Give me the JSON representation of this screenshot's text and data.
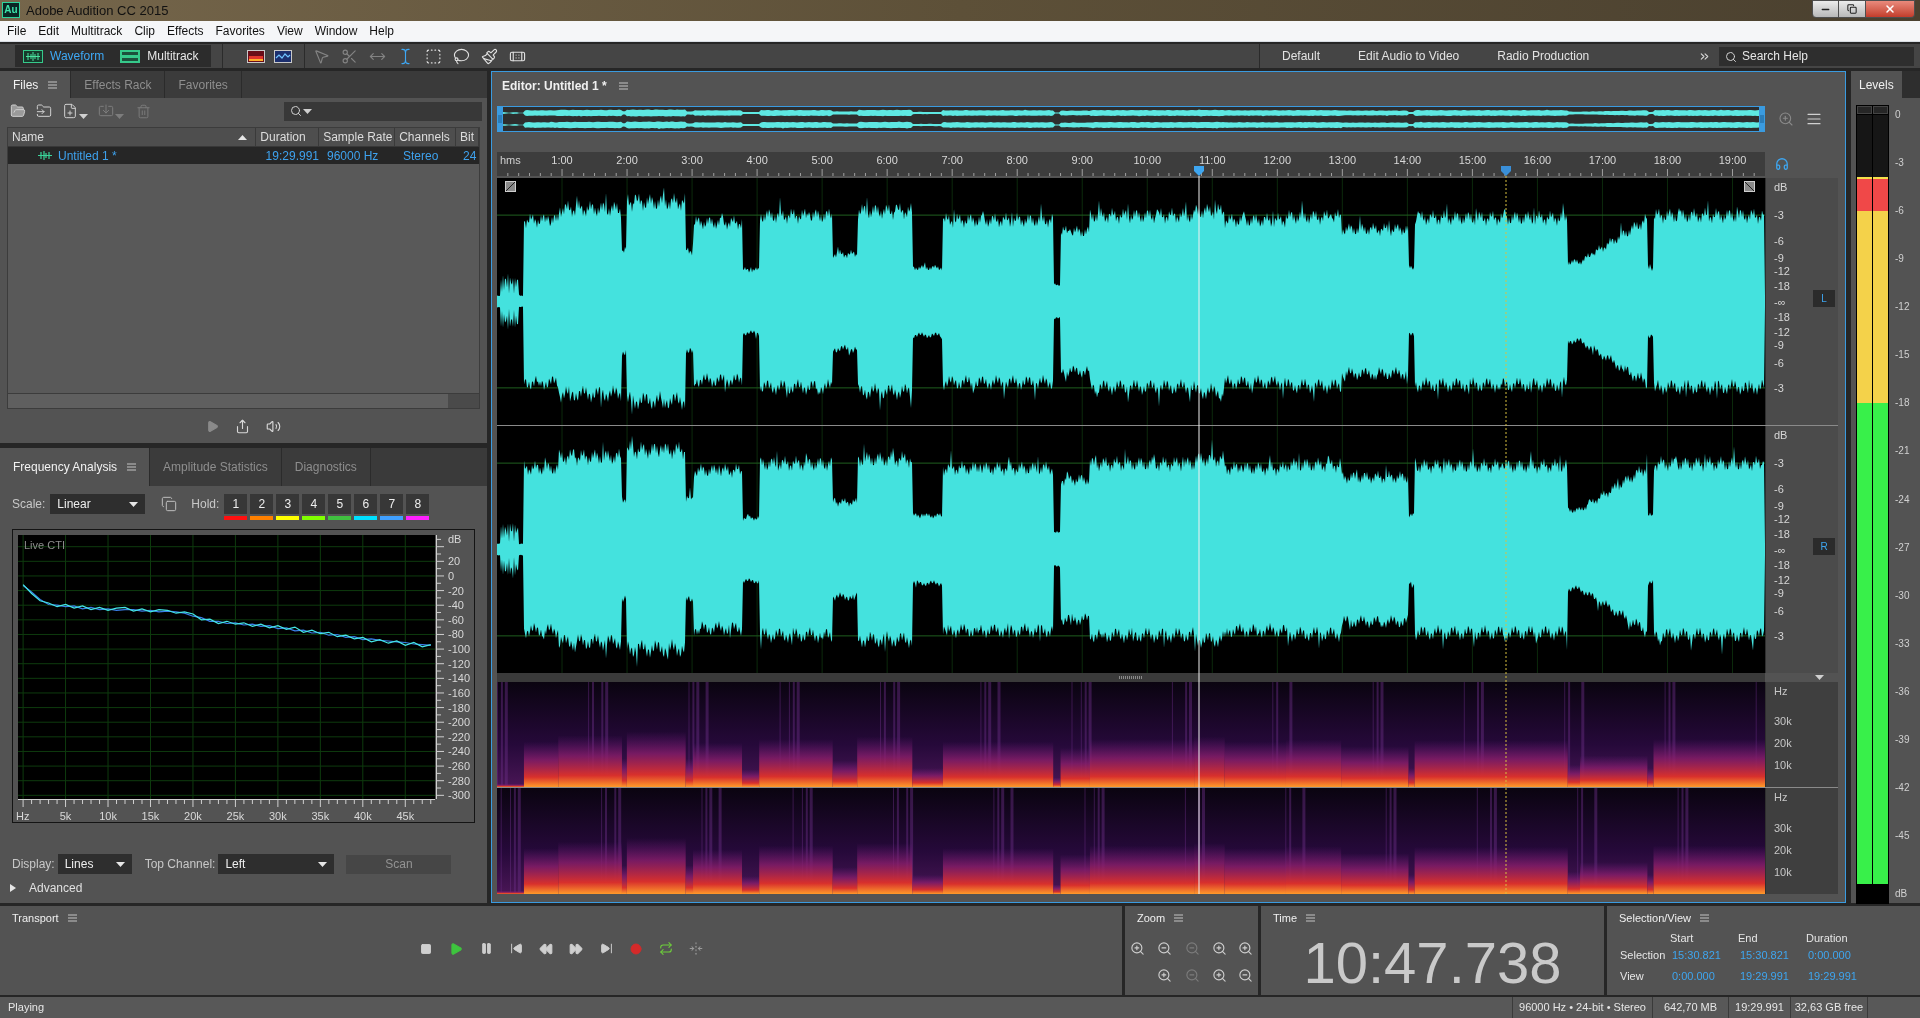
{
  "window": {
    "logo": "Au",
    "title": "Adobe Audition CC 2015"
  },
  "menu": [
    "File",
    "Edit",
    "Multitrack",
    "Clip",
    "Effects",
    "Favorites",
    "View",
    "Window",
    "Help"
  ],
  "toolbar": {
    "views": [
      {
        "label": "Waveform",
        "selected": true
      },
      {
        "label": "Multitrack",
        "selected": false
      }
    ],
    "tools": [
      {
        "selected": false,
        "disabled": true
      },
      {
        "selected": false,
        "disabled": true
      },
      {
        "selected": false,
        "disabled": true
      },
      {
        "selected": true,
        "disabled": false
      },
      {
        "selected": false,
        "disabled": false
      },
      {
        "selected": false,
        "disabled": false
      },
      {
        "selected": false,
        "disabled": false
      },
      {
        "selected": false,
        "disabled": false
      }
    ],
    "workspaces": [
      "Default",
      "Edit Audio to Video",
      "Radio Production"
    ],
    "search": {
      "placeholder": "Search Help"
    }
  },
  "files_panel": {
    "tabs": [
      {
        "label": "Files",
        "selected": true
      },
      {
        "label": "Effects Rack",
        "selected": false
      },
      {
        "label": "Favorites",
        "selected": false
      }
    ],
    "columns": [
      {
        "label": "Name",
        "sort_ascending": true
      },
      {
        "label": "Duration"
      },
      {
        "label": "Sample Rate"
      },
      {
        "label": "Channels"
      },
      {
        "label": "Bit"
      }
    ],
    "rows": [
      {
        "name": "Untitled 1 *",
        "duration": "19:29.991",
        "sample_rate": "96000 Hz",
        "channels": "Stereo",
        "column_5": "24",
        "selected": true
      }
    ]
  },
  "frequency_panel": {
    "tabs": [
      {
        "label": "Frequency Analysis",
        "selected": true
      },
      {
        "label": "Amplitude Statistics",
        "selected": false
      },
      {
        "label": "Diagnostics",
        "selected": false
      }
    ],
    "scale": {
      "label": "Scale:",
      "value": "Linear"
    },
    "hold": {
      "label": "Hold:",
      "buttons": [
        {
          "label": "1",
          "color": "#ff1010"
        },
        {
          "label": "2",
          "color": "#ff8000"
        },
        {
          "label": "3",
          "color": "#ffff00"
        },
        {
          "label": "4",
          "color": "#80ff00"
        },
        {
          "label": "5",
          "color": "#40c040"
        },
        {
          "label": "6",
          "color": "#00e0ff"
        },
        {
          "label": "7",
          "color": "#40a0ff"
        },
        {
          "label": "8",
          "color": "#ff20ff"
        }
      ]
    },
    "plot_label": "Live CTI",
    "chart_data": {
      "type": "line",
      "xlabel": "Hz",
      "ylabel": "dB",
      "x": [
        0,
        1000,
        2000,
        3000,
        4000,
        5000,
        6000,
        7000,
        8000,
        9000,
        10000,
        11000,
        12000,
        13000,
        14000,
        15000,
        16000,
        17000,
        18000,
        19000,
        20000,
        21000,
        22000,
        23000,
        24000,
        25000,
        26000,
        27000,
        28000,
        29000,
        30000,
        31000,
        32000,
        33000,
        34000,
        35000,
        36000,
        37000,
        38000,
        39000,
        40000,
        41000,
        42000,
        43000,
        44000,
        45000,
        46000,
        47000,
        48000
      ],
      "series": [
        {
          "color": "#3a7ee8",
          "values": [
            -13,
            -22,
            -32,
            -39,
            -40,
            -42,
            -41,
            -45,
            -43,
            -46,
            -45,
            -47,
            -46,
            -46,
            -48,
            -47,
            -49,
            -48,
            -49,
            -51,
            -55,
            -57,
            -62,
            -62,
            -65,
            -64,
            -67,
            -66,
            -69,
            -68,
            -72,
            -71,
            -75,
            -74,
            -78,
            -77,
            -81,
            -80,
            -84,
            -83,
            -87,
            -86,
            -88,
            -89,
            -90,
            -91,
            -93,
            -94,
            -95
          ]
        },
        {
          "color": "#44e6e6",
          "values": [
            -12,
            -24,
            -34,
            -37,
            -42,
            -39,
            -44,
            -41,
            -46,
            -43,
            -47,
            -44,
            -43,
            -48,
            -45,
            -49,
            -46,
            -47,
            -51,
            -49,
            -52,
            -60,
            -59,
            -65,
            -62,
            -66,
            -64,
            -69,
            -66,
            -71,
            -68,
            -73,
            -70,
            -77,
            -74,
            -79,
            -77,
            -83,
            -81,
            -86,
            -84,
            -90,
            -87,
            -92,
            -89,
            -95,
            -91,
            -97,
            -94
          ]
        }
      ],
      "xlim": [
        -600,
        48500
      ],
      "ylim": [
        -305,
        56
      ],
      "xticks": [
        {
          "value": 5000,
          "label": "5k"
        },
        {
          "value": 10000,
          "label": "10k"
        },
        {
          "value": 15000,
          "label": "15k"
        },
        {
          "value": 20000,
          "label": "20k"
        },
        {
          "value": 25000,
          "label": "25k"
        },
        {
          "value": 30000,
          "label": "30k"
        },
        {
          "value": 35000,
          "label": "35k"
        },
        {
          "value": 40000,
          "label": "40k"
        },
        {
          "value": 45000,
          "label": "45k"
        }
      ],
      "yticks": [
        20,
        0,
        -20,
        -40,
        -60,
        -80,
        -100,
        -120,
        -140,
        -160,
        -180,
        -200,
        -220,
        -240,
        -260,
        -280,
        -300
      ],
      "grid": true
    },
    "display": {
      "label": "Display:",
      "value": "Lines"
    },
    "top_channel": {
      "label": "Top Channel:",
      "value": "Left"
    },
    "scan": {
      "label": "Scan",
      "disabled": true
    },
    "advanced": {
      "label": "Advanced",
      "expanded": false
    }
  },
  "editor": {
    "tab": {
      "label": "Editor: Untitled 1 *"
    },
    "ruler": {
      "unit": "hms",
      "labels": [
        "1:00",
        "2:00",
        "3:00",
        "4:00",
        "5:00",
        "6:00",
        "7:00",
        "8:00",
        "9:00",
        "10:00",
        "11:00",
        "12:00",
        "13:00",
        "14:00",
        "15:00",
        "16:00",
        "17:00",
        "18:00",
        "19:00"
      ]
    },
    "playhead": {
      "level": 0.5536
    },
    "selection_marker": {
      "level": 0.7956
    },
    "channels": [
      {
        "label": "L",
        "db_scale": [
          "dB",
          "-3",
          "-6",
          "-9",
          "-12",
          "-18",
          "-∞",
          "-18",
          "-12",
          "-9",
          "-6",
          "-3"
        ]
      },
      {
        "label": "R",
        "db_scale": [
          "dB",
          "-3",
          "-6",
          "-9",
          "-12",
          "-18",
          "-∞",
          "-18",
          "-12",
          "-9",
          "-6",
          "-3"
        ]
      }
    ],
    "spectral": [
      {
        "scale": [
          "Hz",
          "30k",
          "20k",
          "10k"
        ]
      },
      {
        "scale": [
          "Hz",
          "30k",
          "20k",
          "10k"
        ]
      }
    ]
  },
  "levels": {
    "tab": {
      "label": "Levels"
    },
    "channels": [
      {
        "level": 0.919
      },
      {
        "level": 0.919
      }
    ],
    "scale": [
      "0",
      "-3",
      "-6",
      "-9",
      "-12",
      "-15",
      "-18",
      "-21",
      "-24",
      "-27",
      "-30",
      "-33",
      "-36",
      "-39",
      "-42",
      "-45",
      "dB"
    ]
  },
  "transport": {
    "title": "Transport"
  },
  "zoom_panel": {
    "title": "Zoom"
  },
  "time_panel": {
    "title": "Time",
    "value": "10:47.738"
  },
  "selection_view": {
    "title": "Selection/View",
    "columns": [
      "Start",
      "End",
      "Duration"
    ],
    "rows": [
      {
        "label": "Selection",
        "values": [
          "15:30.821",
          "15:30.821",
          "0:00.000"
        ]
      },
      {
        "label": "View",
        "values": [
          "0:00.000",
          "19:29.991",
          "19:29.991"
        ]
      }
    ]
  },
  "status_bar": {
    "state": "Playing",
    "format": "96000 Hz • 24-bit • Stereo",
    "size": "642,70 MB",
    "duration": "19:29.991",
    "free_space": "32,63 GB free"
  }
}
